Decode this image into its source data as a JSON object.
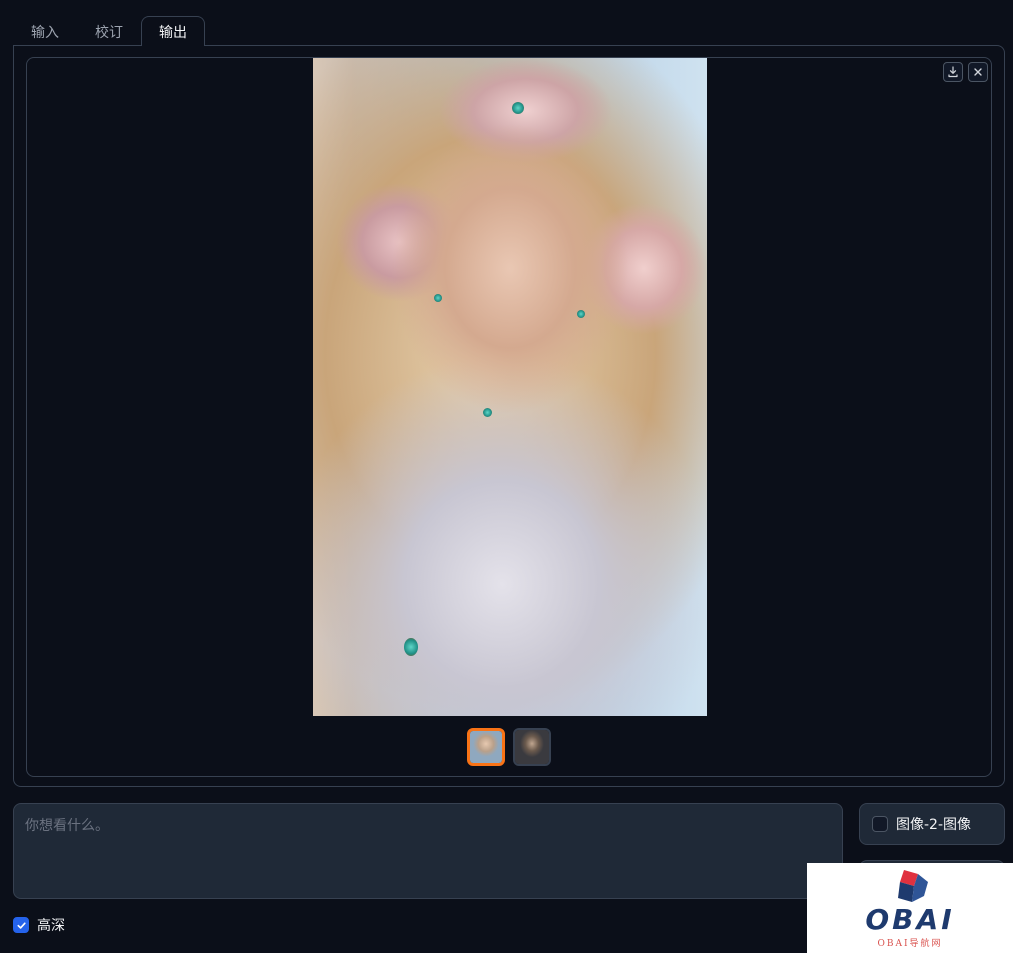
{
  "tabs": [
    {
      "label": "输入",
      "active": false
    },
    {
      "label": "校订",
      "active": false
    },
    {
      "label": "输出",
      "active": true
    }
  ],
  "gallery": {
    "download_icon": "download-icon",
    "close_icon": "close-icon",
    "thumbnail_count": 2,
    "selected_thumbnail": 1
  },
  "prompt": {
    "placeholder": "你想看什么。",
    "value": ""
  },
  "options": {
    "img2img_label": "图像-2-图像",
    "img2img_checked": false,
    "hd_label": "高深",
    "hd_checked": true
  },
  "watermark": {
    "brand": "OBAI",
    "sub": "OBAI导航网"
  },
  "colors": {
    "accent_selected": "#f97316",
    "checkbox_on": "#2563eb",
    "background": "#0b0f19",
    "border": "#374151"
  }
}
